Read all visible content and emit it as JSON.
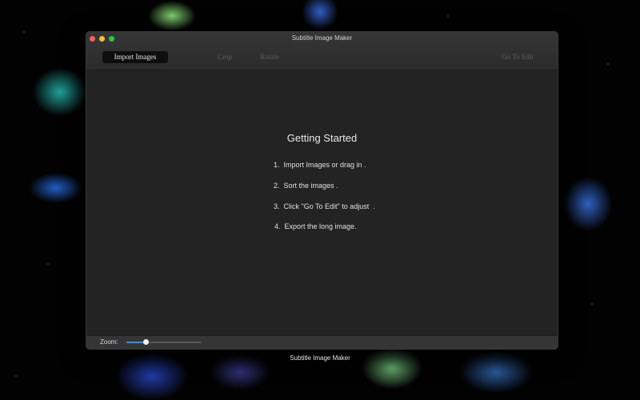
{
  "window": {
    "title": "Subtitle Image Maker"
  },
  "toolbar": {
    "import_label": "Import Images",
    "crop_label": "Crop",
    "rotate_label": "Rotate",
    "go_to_edit_label": "Go To Edit"
  },
  "main": {
    "heading": "Getting Started",
    "steps": [
      "1.  Import Images or drag in .",
      "2.  Sort the images .",
      "3.  Click \"Go To Edit\" to adjust  .",
      "4.  Export the long image."
    ]
  },
  "bottom": {
    "zoom_label": "Zoom:",
    "zoom_level": 0.25
  },
  "dock": {
    "app_label": "Subtitle Image Maker"
  },
  "colors": {
    "accent": "#3b8cff",
    "close": "#fc5f57",
    "minimize": "#fdbc2e",
    "maximize": "#29c941"
  }
}
